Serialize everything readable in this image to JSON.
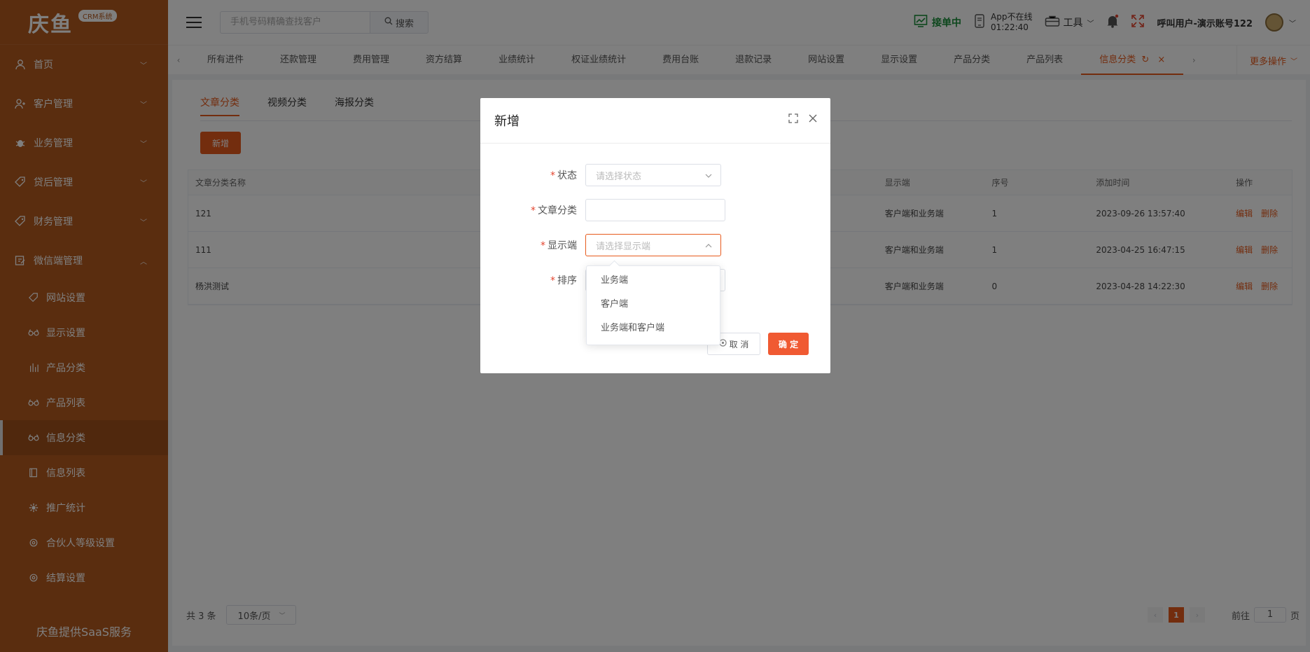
{
  "brand": {
    "logo_text": "庆鱼",
    "badge": "CRM系统",
    "footer": "庆鱼提供SaaS服务"
  },
  "sidebar": {
    "items": [
      {
        "label": "首页",
        "icon": "user-icon"
      },
      {
        "label": "客户管理",
        "icon": "customer-icon"
      },
      {
        "label": "业务管理",
        "icon": "bug-icon"
      },
      {
        "label": "贷后管理",
        "icon": "tag-icon"
      },
      {
        "label": "财务管理",
        "icon": "tag-icon"
      },
      {
        "label": "微信端管理",
        "icon": "edit-icon"
      }
    ],
    "sub_items": [
      {
        "label": "网站设置",
        "icon": "tag-icon"
      },
      {
        "label": "显示设置",
        "icon": "glasses-icon"
      },
      {
        "label": "产品分类",
        "icon": "bars-icon"
      },
      {
        "label": "产品列表",
        "icon": "glasses-icon"
      },
      {
        "label": "信息分类",
        "icon": "glasses-icon"
      },
      {
        "label": "信息列表",
        "icon": "book-icon"
      },
      {
        "label": "推广统计",
        "icon": "gear-icon"
      },
      {
        "label": "合伙人等级设置",
        "icon": "gear-icon"
      },
      {
        "label": "结算设置",
        "icon": "gear-icon"
      }
    ]
  },
  "header": {
    "search_placeholder": "手机号码精确查找客户",
    "search_label": "搜索",
    "receiving": "接单中",
    "app_status_line1": "App不在线",
    "app_status_line2": "01:22:40",
    "tools": "工具",
    "user": "呼叫用户-演示账号122"
  },
  "tabs": {
    "items": [
      "所有进件",
      "还款管理",
      "费用管理",
      "资方结算",
      "业绩统计",
      "权证业绩统计",
      "费用台账",
      "退款记录",
      "网站设置",
      "显示设置",
      "产品分类",
      "产品列表",
      "信息分类"
    ],
    "more": "更多操作"
  },
  "content": {
    "sub_tabs": [
      "文章分类",
      "视频分类",
      "海报分类"
    ],
    "add_label": "新增",
    "table": {
      "headers": [
        "文章分类名称",
        "显示端",
        "序号",
        "添加时间",
        "操作"
      ],
      "rows": [
        {
          "name": "121",
          "display": "客户端和业务端",
          "order": "1",
          "time": "2023-09-26 13:57:40"
        },
        {
          "name": "111",
          "display": "客户端和业务端",
          "order": "1",
          "time": "2023-04-25 16:47:15"
        },
        {
          "name": "杨洪测试",
          "display": "客户端和业务端",
          "order": "0",
          "time": "2023-04-28 14:22:30"
        }
      ],
      "edit": "编辑",
      "delete": "删除"
    },
    "pager": {
      "total": "共 3 条",
      "page_size": "10条/页",
      "current": "1",
      "goto": "前往",
      "goto_value": "1",
      "page_unit": "页"
    }
  },
  "modal": {
    "title": "新增",
    "required_mark": "*",
    "fields": {
      "status_label": "状态",
      "status_placeholder": "请选择状态",
      "category_label": "文章分类",
      "display_label": "显示端",
      "display_placeholder": "请选择显示端",
      "order_label": "排序"
    },
    "cancel": "取 消",
    "ok": "确 定"
  },
  "dropdown": {
    "options": [
      "业务端",
      "客户端",
      "业务端和客户端"
    ]
  },
  "colors": {
    "sidebar": "#b55a1f",
    "accent": "#e75a1c",
    "confirm": "#f05a32",
    "receiving": "#1a8f3a"
  }
}
